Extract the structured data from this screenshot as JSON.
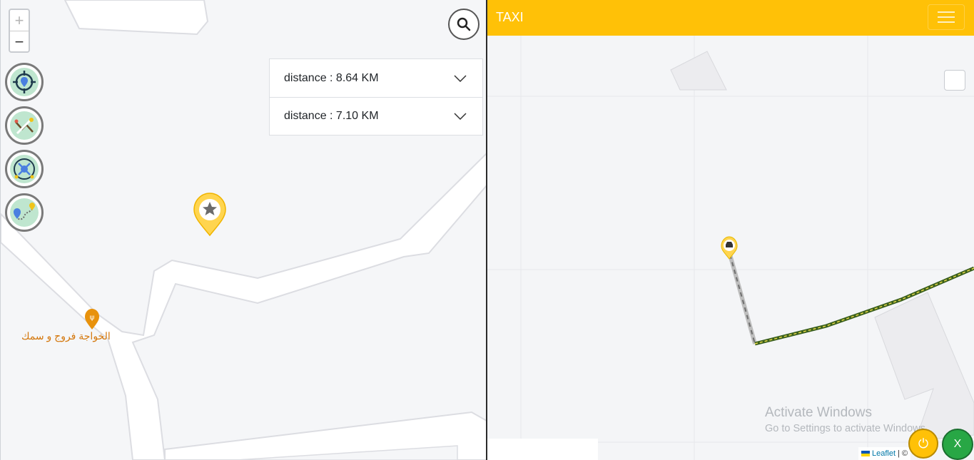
{
  "left_map": {
    "zoom_in": "+",
    "zoom_out": "−",
    "tools": [
      {
        "icon": "location-target-icon"
      },
      {
        "icon": "route-edit-icon"
      },
      {
        "icon": "area-select-icon"
      },
      {
        "icon": "directions-icon"
      }
    ],
    "search_icon": "search-icon",
    "distances": [
      {
        "label": "distance : 8.64 KM"
      },
      {
        "label": "distance : 7.10 KM"
      }
    ],
    "poi_label": "الخواجة فروج و سمك",
    "colors": {
      "marker": "#ffd54f",
      "poi": "#e8920c"
    }
  },
  "right_panel": {
    "brand": "TAXI",
    "navbar_color": "#ffc107",
    "activate_title": "Activate Windows",
    "activate_sub": "Go to Settings to activate Windows.",
    "attribution_link": "Leaflet",
    "attribution_rest": " | © ",
    "power_icon": "⏻",
    "close_label": "X",
    "route_color": "#3a5f1c"
  }
}
